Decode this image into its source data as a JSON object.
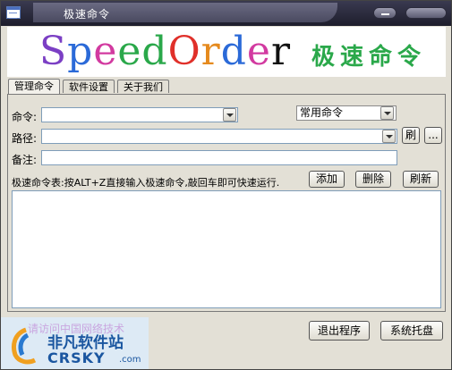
{
  "window": {
    "title": "极速命令"
  },
  "banner": {
    "logo_letters": [
      {
        "ch": "S",
        "color": "#7b3fc4"
      },
      {
        "ch": "p",
        "color": "#2b6ad8"
      },
      {
        "ch": "e",
        "color": "#d23aa0"
      },
      {
        "ch": "e",
        "color": "#2aa84a"
      },
      {
        "ch": "d",
        "color": "#2aa84a"
      },
      {
        "ch": "O",
        "color": "#e0302a"
      },
      {
        "ch": "r",
        "color": "#e58a1e"
      },
      {
        "ch": "d",
        "color": "#2b6ad8"
      },
      {
        "ch": "e",
        "color": "#d23aa0"
      },
      {
        "ch": "r",
        "color": "#111111"
      }
    ],
    "subtitle": "极速命令"
  },
  "tabs": [
    {
      "label": "管理命令",
      "active": true
    },
    {
      "label": "软件设置",
      "active": false
    },
    {
      "label": "关于我们",
      "active": false
    }
  ],
  "form": {
    "command_label": "命令:",
    "command_value": "",
    "category_value": "常用命令",
    "path_label": "路径:",
    "path_value": "",
    "refresh_small_label": "刷",
    "browse_label": "...",
    "note_label": "备注:",
    "note_value": ""
  },
  "list": {
    "hint": "极速命令表:按ALT+Z直接输入极速命令,敲回车即可快速运行.",
    "add_label": "添加",
    "delete_label": "删除",
    "refresh_label": "刷新",
    "rows": []
  },
  "footer": {
    "exit_label": "退出程序",
    "tray_label": "系统托盘"
  },
  "watermark": {
    "faint_text": "请访问中国网络技术",
    "cn": "非凡软件站",
    "en": "CRSKY",
    "dotcom": ".com"
  }
}
